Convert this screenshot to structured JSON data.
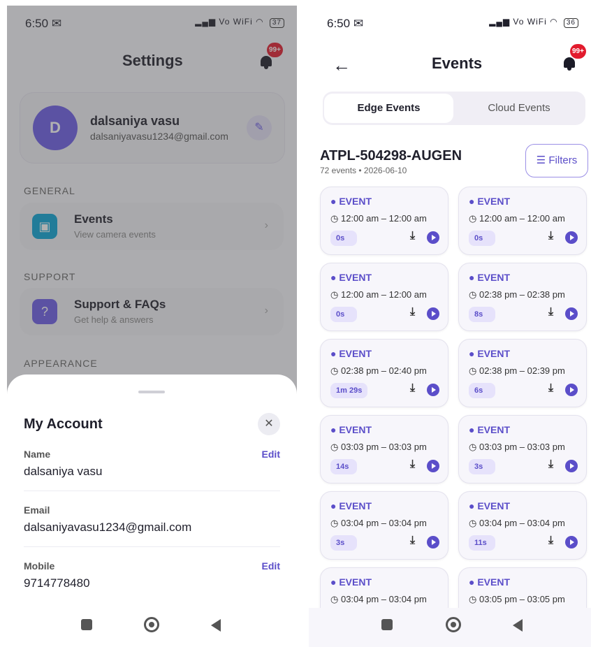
{
  "left": {
    "status": {
      "time": "6:50",
      "mail_icon": "✉",
      "net": "Vo WiFi",
      "battery": "37"
    },
    "title": "Settings",
    "notif_badge": "99+",
    "profile": {
      "initial": "D",
      "name": "dalsaniya vasu",
      "email": "dalsaniyavasu1234@gmail.com"
    },
    "sections": {
      "general": "GENERAL",
      "support": "SUPPORT",
      "appearance": "APPEARANCE"
    },
    "events_row": {
      "title": "Events",
      "subtitle": "View camera events"
    },
    "support_row": {
      "title": "Support & FAQs",
      "subtitle": "Get help & answers"
    },
    "sheet": {
      "title": "My Account",
      "name_label": "Name",
      "name_value": "dalsaniya vasu",
      "email_label": "Email",
      "email_value": "dalsaniyavasu1234@gmail.com",
      "mobile_label": "Mobile",
      "mobile_value": "9714778480",
      "edit_label": "Edit"
    }
  },
  "right": {
    "status": {
      "time": "6:50",
      "mail_icon": "✉",
      "net": "Vo WiFi",
      "battery": "36"
    },
    "title": "Events",
    "notif_badge": "99+",
    "tabs": {
      "active": "Edge Events",
      "other": "Cloud Events"
    },
    "device": "ATPL-504298-AUGEN",
    "meta": "72 events • 2026-06-10",
    "filters_label": "Filters",
    "event_label": "● EVENT",
    "events": [
      {
        "time": "12:00 am – 12:00 am",
        "duration": "0s"
      },
      {
        "time": "12:00 am – 12:00 am",
        "duration": "0s"
      },
      {
        "time": "12:00 am – 12:00 am",
        "duration": "0s"
      },
      {
        "time": "02:38 pm – 02:38 pm",
        "duration": "8s"
      },
      {
        "time": "02:38 pm – 02:40 pm",
        "duration": "1m 29s"
      },
      {
        "time": "02:38 pm – 02:39 pm",
        "duration": "6s"
      },
      {
        "time": "03:03 pm – 03:03 pm",
        "duration": "14s"
      },
      {
        "time": "03:03 pm – 03:03 pm",
        "duration": "3s"
      },
      {
        "time": "03:04 pm – 03:04 pm",
        "duration": "3s"
      },
      {
        "time": "03:04 pm – 03:04 pm",
        "duration": "11s"
      },
      {
        "time": "03:04 pm – 03:04 pm",
        "duration": ""
      },
      {
        "time": "03:05 pm – 03:05 pm",
        "duration": ""
      }
    ]
  }
}
